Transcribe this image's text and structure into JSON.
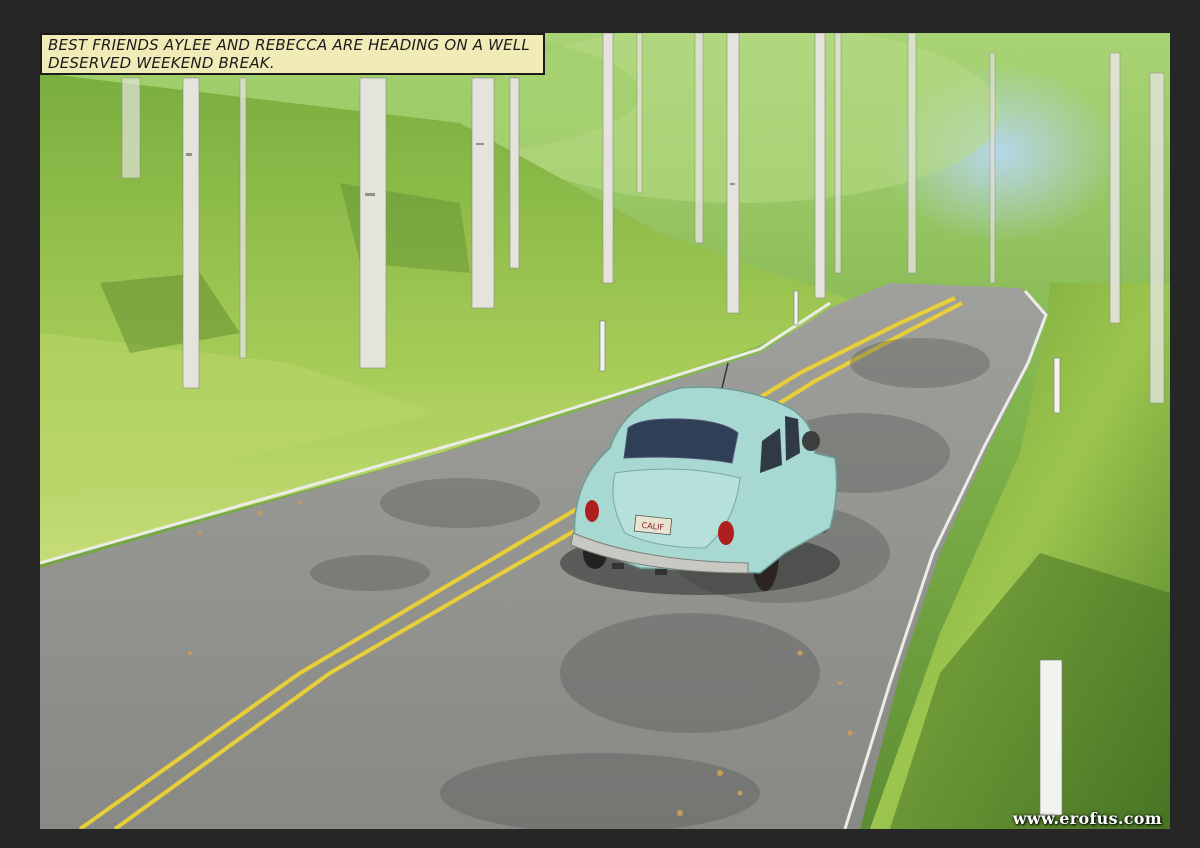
{
  "caption": {
    "text": "Best friends Aylee and Rebecca are heading on a well deserved weekend break."
  },
  "watermark": {
    "text": "www.erofus.com"
  },
  "scene": {
    "car_plate": "CALIF",
    "colors": {
      "border": "#262626",
      "caption_bg": "#f1ecb7",
      "grass": "#8cbd4a",
      "road": "#8e8f8c",
      "road_line": "#e8cf3a",
      "car_body": "#a8d8d2"
    }
  }
}
